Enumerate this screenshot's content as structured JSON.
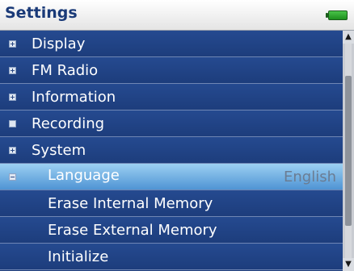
{
  "header": {
    "title": "Settings",
    "battery_icon": "battery-icon"
  },
  "menu": {
    "items": [
      {
        "label": "Display",
        "bullet": "+",
        "value": ""
      },
      {
        "label": "FM Radio",
        "bullet": "+",
        "value": ""
      },
      {
        "label": "Information",
        "bullet": "+",
        "value": ""
      },
      {
        "label": "Recording",
        "bullet": "",
        "value": ""
      },
      {
        "label": "System",
        "bullet": "+",
        "value": ""
      },
      {
        "label": "Language",
        "bullet": "−",
        "value": "English",
        "selected": true
      },
      {
        "label": "Erase Internal Memory",
        "bullet": "",
        "value": "",
        "child": true
      },
      {
        "label": "Erase External Memory",
        "bullet": "",
        "value": "",
        "child": true
      },
      {
        "label": "Initialize",
        "bullet": "",
        "value": "",
        "child": true
      }
    ]
  },
  "scrollbar": {
    "up_arrow": "▲",
    "down_arrow": "▼",
    "position": 0.5,
    "visible_fraction": 0.7
  },
  "colors": {
    "background": "#1e3d7a",
    "selected": "#5aa0dc",
    "header_text": "#1a3a78"
  }
}
